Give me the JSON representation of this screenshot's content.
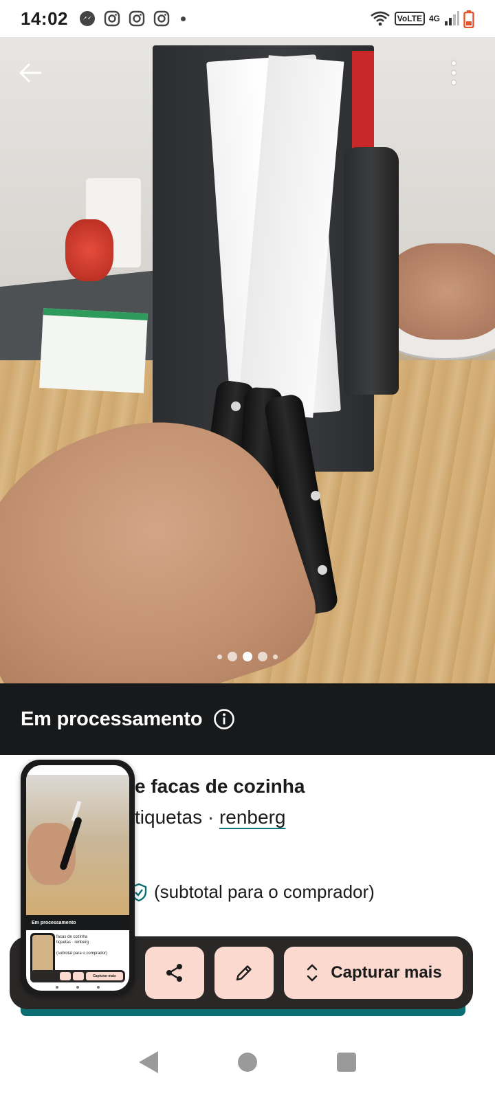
{
  "status_bar": {
    "time": "14:02",
    "network_label": "4G",
    "volte_label": "VoLTE",
    "left_icons": [
      "messenger-icon",
      "instagram-icon",
      "instagram-icon",
      "instagram-icon"
    ],
    "right_icons": [
      "wifi-icon",
      "volte-icon",
      "signal-icon",
      "battery-low-icon"
    ]
  },
  "photo": {
    "carousel_total": 5,
    "carousel_active_index": 2
  },
  "processing_banner": {
    "text": "Em processamento",
    "icon": "info-icon"
  },
  "listing": {
    "title_visible": "e facas de cozinha",
    "subtitle_visible": "tiquetas · ",
    "brand_link": "renberg",
    "price_note": "(subtotal para o comprador)"
  },
  "actions": {
    "capture_label": "Capturar mais",
    "share_icon": "share-icon",
    "edit_icon": "pencil-icon",
    "capture_icon": "expand-vertical-icon"
  },
  "thumbnail": {
    "banner_text": "Em processamento",
    "title_line1": "facas de cozinha",
    "title_line2": "tiquetas · renberg",
    "price_line": "(subtotal para o comprador)",
    "capture_label": "Capturar mais"
  },
  "colors": {
    "banner_bg": "#17191b",
    "action_button_bg": "#fbd9cf",
    "action_pill_bg": "#2a2727",
    "accent_teal": "#0c6e72"
  }
}
